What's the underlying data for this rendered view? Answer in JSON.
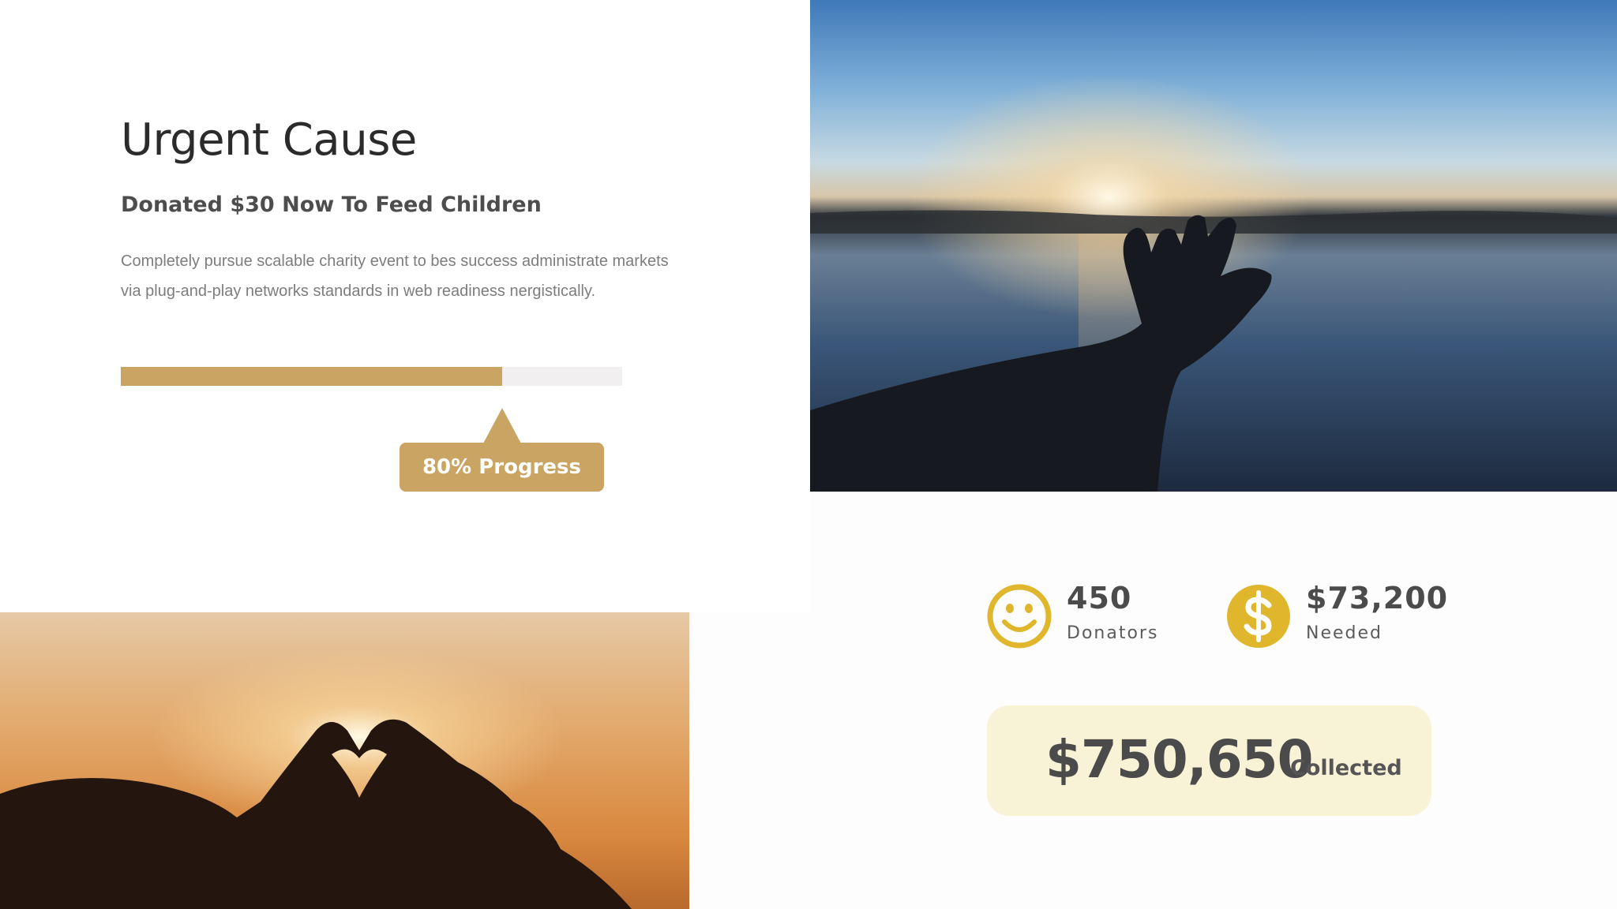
{
  "cause": {
    "title": "Urgent Cause",
    "subtitle": "Donated $30 Now To Feed Children",
    "description": "Completely pursue scalable charity event to bes success administrate markets via plug-and-play networks standards in web readiness nergistically.",
    "progress_percent": 76,
    "progress_label": "80% Progress"
  },
  "stats": {
    "donators": {
      "value": "450",
      "label": "Donators",
      "icon": "smiley-icon"
    },
    "needed": {
      "value": "$73,200",
      "label": "Needed",
      "icon": "dollar-icon"
    }
  },
  "collected": {
    "amount": "$750,650",
    "label": "Collected"
  },
  "colors": {
    "accent": "#c9a463",
    "icon_yellow": "#e0b72c",
    "card_bg": "#f8f3d6",
    "track": "#f1eff0"
  }
}
